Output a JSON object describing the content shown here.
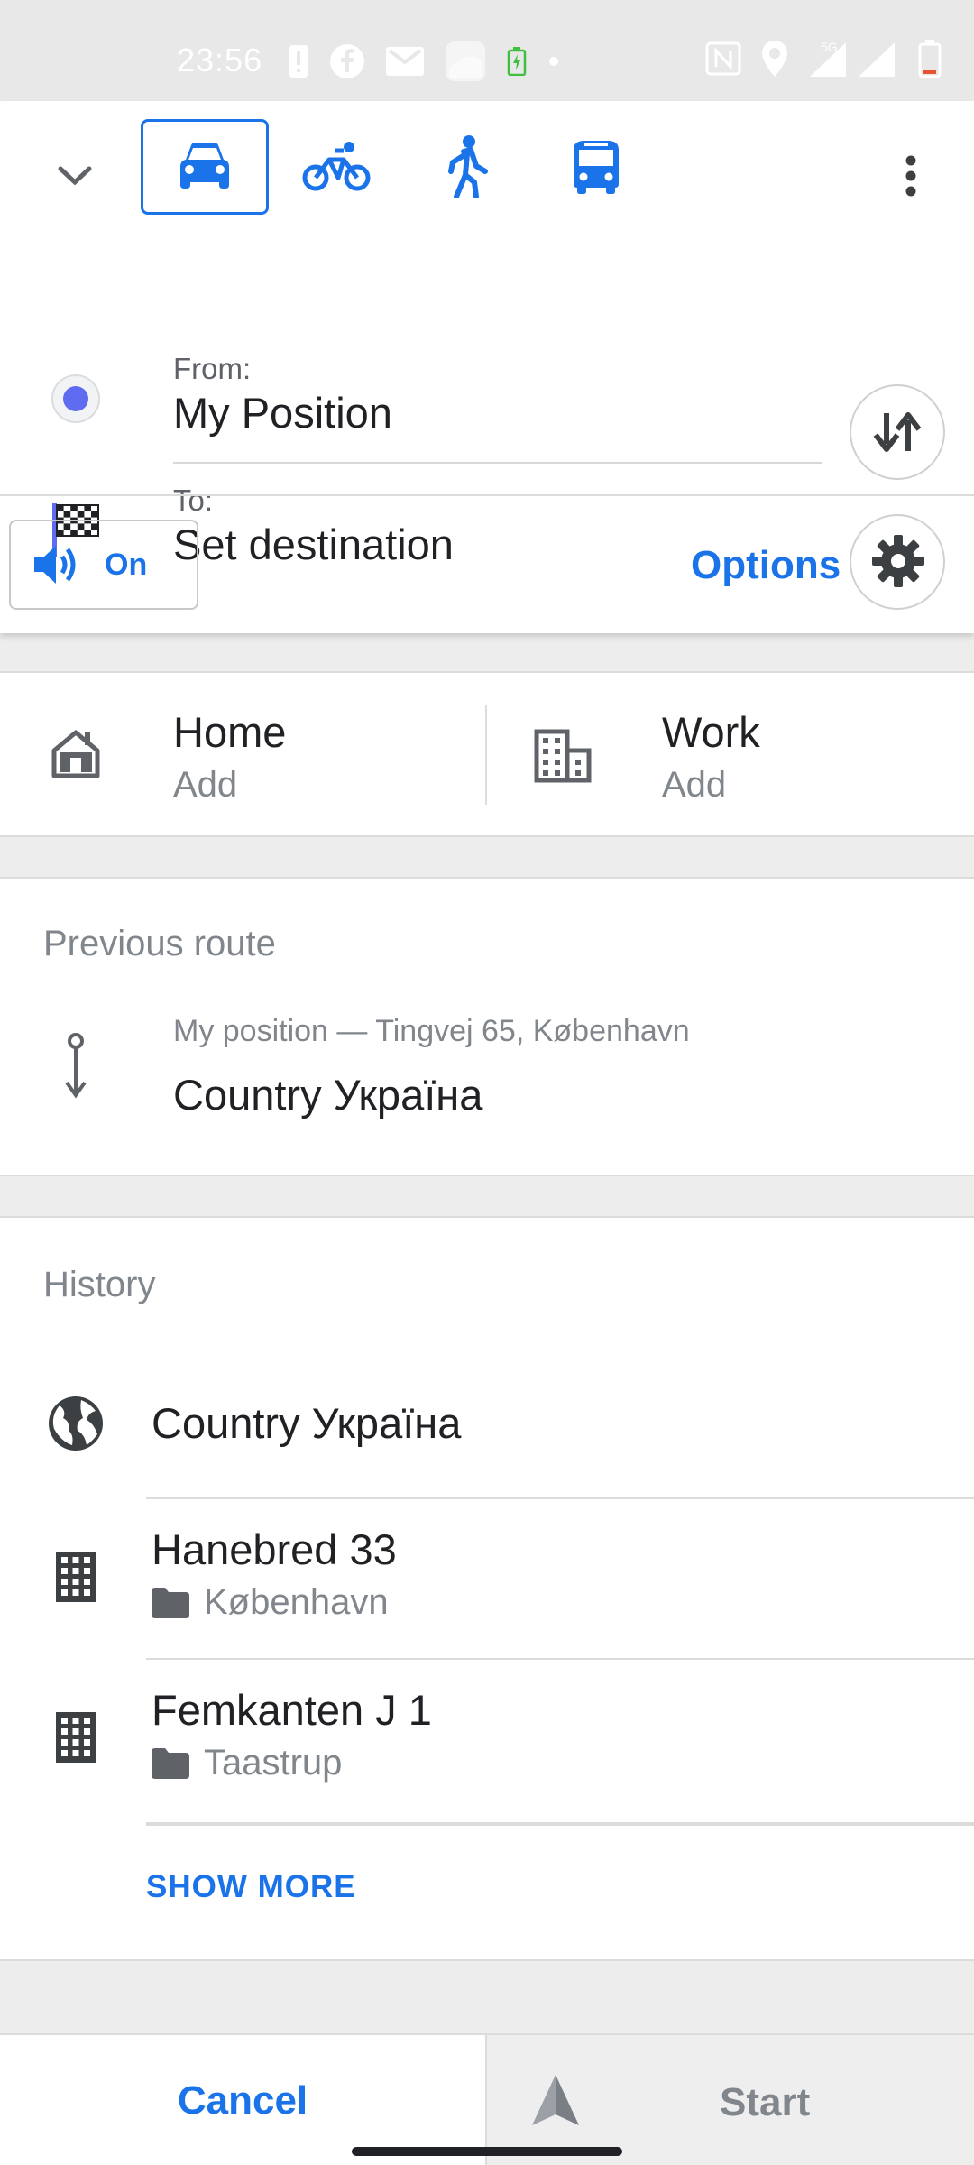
{
  "status_bar": {
    "time": "23:56",
    "network": "5G",
    "icons": [
      "alert-icon",
      "facebook-icon",
      "gmail-icon",
      "app-icon",
      "battery-saver-icon",
      "dot-icon",
      "nfc-icon",
      "location-icon",
      "signal-icon",
      "battery-icon"
    ]
  },
  "header": {
    "modes": [
      {
        "name": "car",
        "selected": true
      },
      {
        "name": "bicycle",
        "selected": false
      },
      {
        "name": "pedestrian",
        "selected": false
      },
      {
        "name": "public-transport",
        "selected": false
      }
    ]
  },
  "route": {
    "from_label": "From:",
    "from_value": "My Position",
    "to_label": "To:",
    "to_value": "Set destination"
  },
  "voice": {
    "label": "On"
  },
  "options": {
    "label": "Options"
  },
  "shortcuts": {
    "home": {
      "title": "Home",
      "sub": "Add"
    },
    "work": {
      "title": "Work",
      "sub": "Add"
    }
  },
  "previous_route": {
    "heading": "Previous route",
    "meta": "My position — Tingvej 65, København",
    "title": "Country Україна"
  },
  "history": {
    "heading": "History",
    "items": [
      {
        "title": "Country Україна",
        "sub": "",
        "icon": "globe-icon"
      },
      {
        "title": "Hanebred 33",
        "sub": "København",
        "icon": "building-icon"
      },
      {
        "title": "Femkanten J 1",
        "sub": "Taastrup",
        "icon": "building-icon"
      }
    ],
    "show_more": "SHOW MORE"
  },
  "footer": {
    "cancel": "Cancel",
    "start": "Start"
  },
  "colors": {
    "accent": "#1a73e8",
    "selection_dot": "#5f6cf2"
  }
}
